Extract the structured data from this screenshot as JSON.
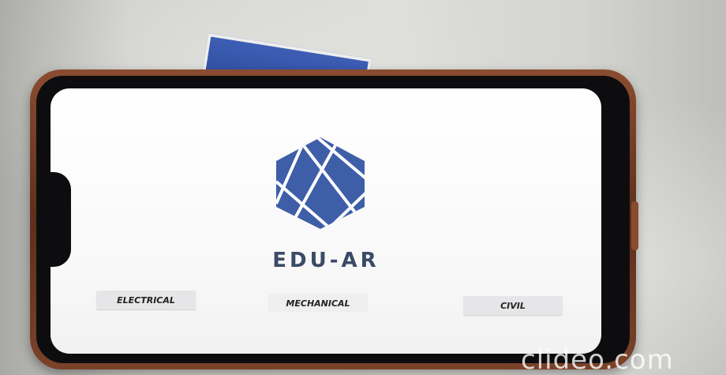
{
  "app": {
    "title": "EDU-AR",
    "logo_icon": "hexagon-logo-icon",
    "brand_color": "#3e5ea8",
    "title_color": "#3b4a66"
  },
  "categories": [
    {
      "label": "ELECTRICAL"
    },
    {
      "label": "MECHANICAL"
    },
    {
      "label": "CIVIL"
    }
  ],
  "watermark": {
    "text": "clideo.com"
  }
}
